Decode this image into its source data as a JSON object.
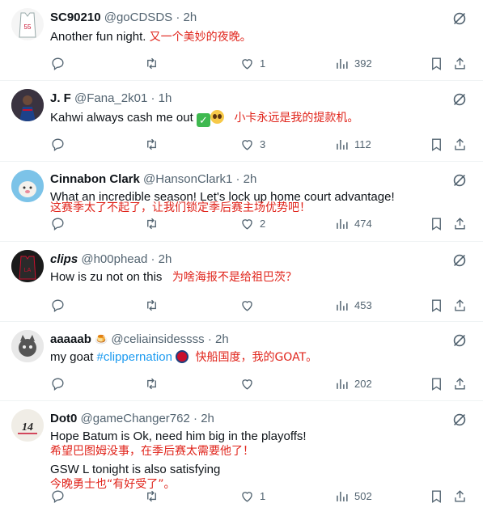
{
  "tweets": [
    {
      "name": "SC90210",
      "handle": "@goCDSDS",
      "sep": "·",
      "time": "2h",
      "lines": [
        {
          "text": "Another fun night. ",
          "zh": "又一个美妙的夜晚。"
        }
      ],
      "replies": "",
      "retweets": "",
      "likes": "1",
      "views": "392"
    },
    {
      "name": "J. F",
      "handle": "@Fana_2k01",
      "sep": "·",
      "time": "1h",
      "lines": [
        {
          "text": "Kahwi always  cash me out ",
          "emoji": "✓",
          "zh": "小卡永远是我的提款机。"
        }
      ],
      "replies": "",
      "retweets": "",
      "likes": "3",
      "views": "112"
    },
    {
      "name": "Cinnabon Clark",
      "handle": "@HansonClark1",
      "sep": "·",
      "time": "2h",
      "lines": [
        {
          "text": "What an incredible season! Let's lock up home court advantage!"
        },
        {
          "zh": "这赛季太了不起了，让我们锁定季后赛主场优势吧！"
        }
      ],
      "replies": "",
      "retweets": "",
      "likes": "2",
      "views": "474"
    },
    {
      "name": "clips",
      "handle": "@h00phead",
      "sep": "·",
      "time": "2h",
      "lines": [
        {
          "text": "How is zu not on this   ",
          "zh": "为啥海报不是给祖巴茨？"
        }
      ],
      "replies": "",
      "retweets": "",
      "likes": "",
      "views": "453"
    },
    {
      "name": "aaaaab",
      "name_emoji": "🍮",
      "handle": "@celiainsidessss",
      "sep": "·",
      "time": "2h",
      "lines": [
        {
          "text": "my goat ",
          "hashtag": "#clippernation",
          "zh": "快船国度，我的GOAT。"
        }
      ],
      "replies": "",
      "retweets": "",
      "likes": "",
      "views": "202"
    },
    {
      "name": "Dot0",
      "handle": "@gameChanger762",
      "sep": "·",
      "time": "2h",
      "lines": [
        {
          "text": "Hope Batum is Ok, need him big in the playoffs!"
        },
        {
          "zh": "希望巴图姆没事，在季后赛太需要他了！"
        },
        {
          "text": "GSW L tonight is also satisfying"
        },
        {
          "zh": "今晚勇士也“有好受了”。"
        }
      ],
      "replies": "",
      "retweets": "",
      "likes": "1",
      "views": "502"
    }
  ],
  "icons": {
    "reply": "reply-icon",
    "retweet": "retweet-icon",
    "like": "like-icon",
    "views": "views-icon",
    "bookmark": "bookmark-icon",
    "share": "share-icon",
    "more": "grok-more-icon"
  },
  "colors": {
    "text": "#0f1419",
    "muted": "#536471",
    "translation": "#e0241b",
    "link": "#1d9bf0",
    "divider": "#eff3f4"
  }
}
